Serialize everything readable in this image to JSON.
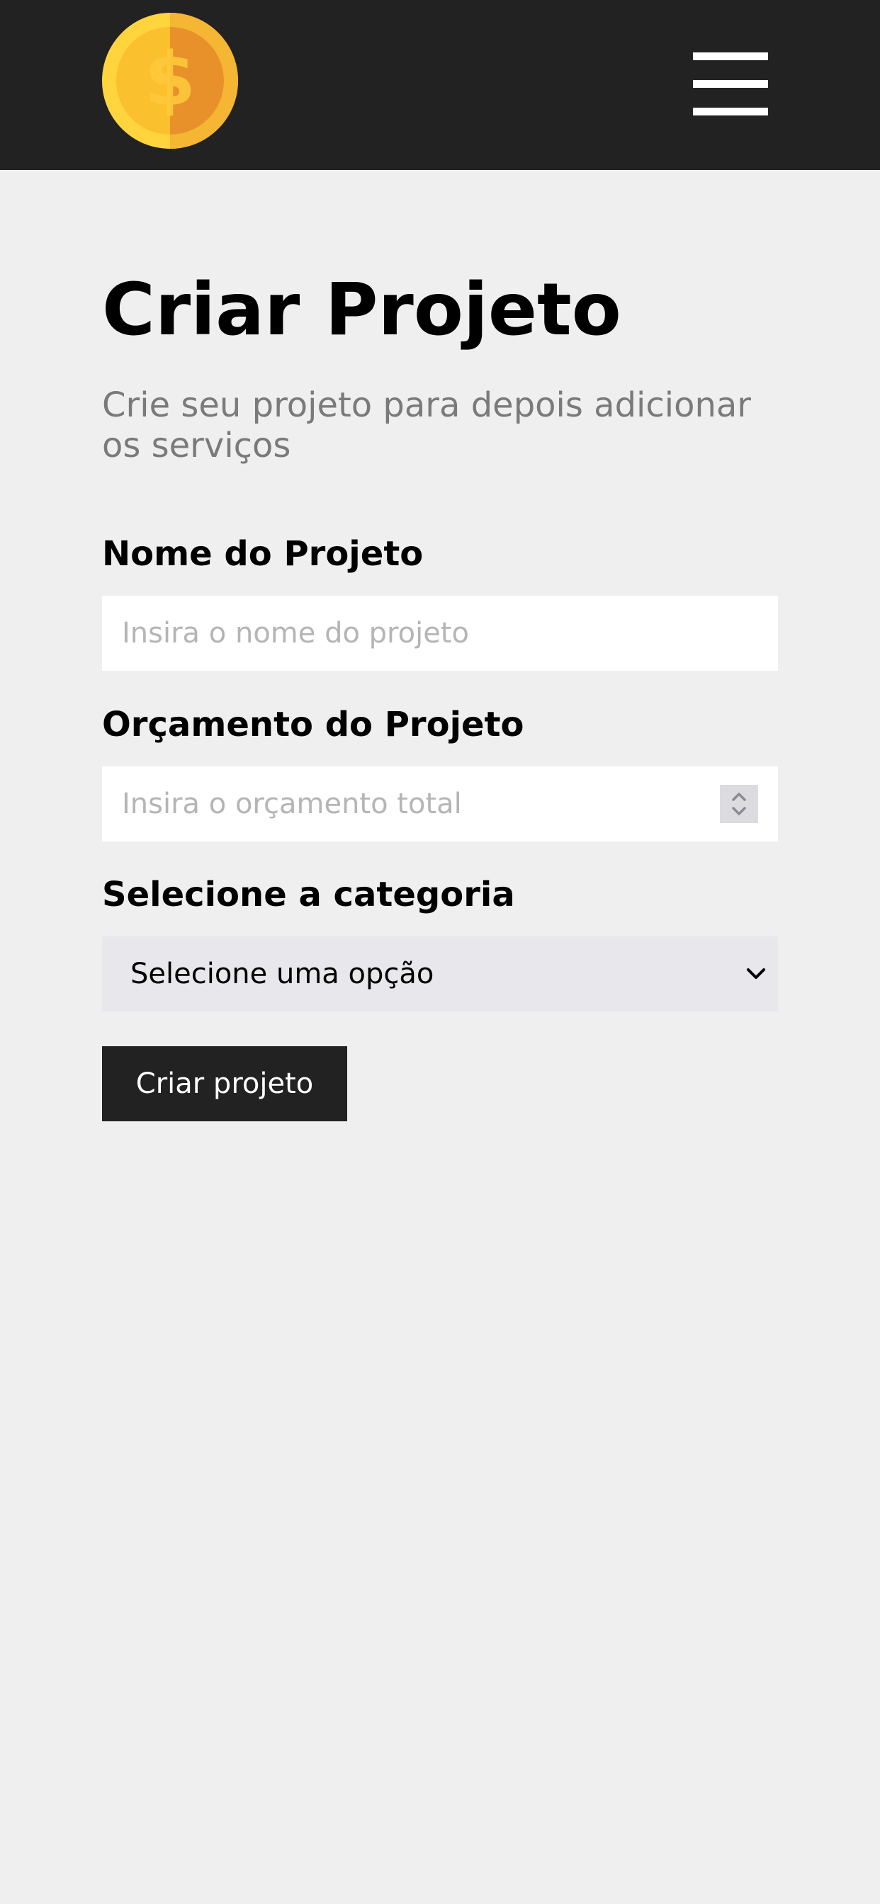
{
  "header": {
    "logo_icon": "dollar-coin-icon",
    "menu_icon": "hamburger-menu-icon",
    "colors": {
      "background": "#222222",
      "coin_light": "#FFD43D",
      "coin_dark": "#F0A02A"
    }
  },
  "main": {
    "title": "Criar Projeto",
    "subtitle": "Crie seu projeto para depois adicionar os serviços",
    "fields": {
      "name": {
        "label": "Nome do Projeto",
        "placeholder": "Insira o nome do projeto",
        "value": ""
      },
      "budget": {
        "label": "Orçamento do Projeto",
        "placeholder": "Insira o orçamento total",
        "value": ""
      },
      "category": {
        "label": "Selecione a categoria",
        "selected": "Selecione uma opção"
      }
    },
    "submit_label": "Criar projeto"
  },
  "colors": {
    "page_background": "#efefef",
    "button_background": "#222222",
    "subtitle_text": "#7a7a7a",
    "placeholder_text": "#b5b5b5"
  }
}
